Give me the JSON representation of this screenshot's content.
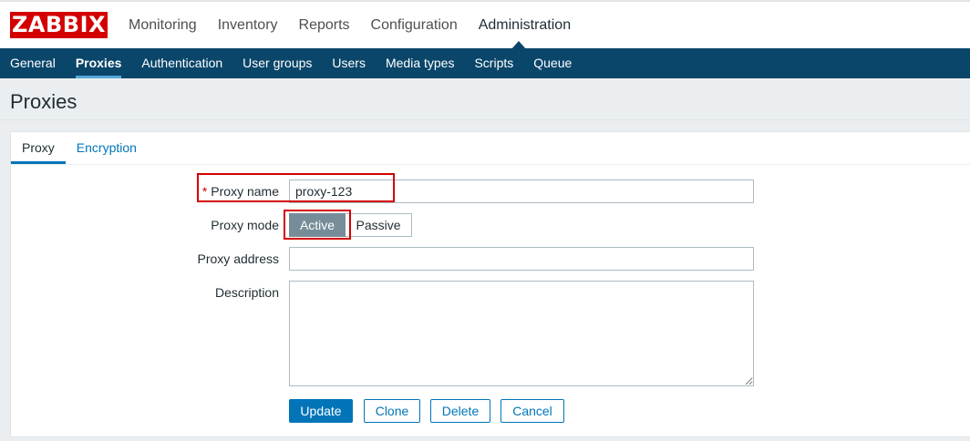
{
  "brand": {
    "logo_text": "ZABBIX",
    "accent": "#d40000"
  },
  "main_menu": {
    "items": [
      {
        "label": "Monitoring"
      },
      {
        "label": "Inventory"
      },
      {
        "label": "Reports"
      },
      {
        "label": "Configuration"
      },
      {
        "label": "Administration"
      }
    ],
    "active": "Administration"
  },
  "sub_menu": {
    "items": [
      {
        "label": "General"
      },
      {
        "label": "Proxies"
      },
      {
        "label": "Authentication"
      },
      {
        "label": "User groups"
      },
      {
        "label": "Users"
      },
      {
        "label": "Media types"
      },
      {
        "label": "Scripts"
      },
      {
        "label": "Queue"
      }
    ],
    "active": "Proxies",
    "background": "#0a466a"
  },
  "page": {
    "title": "Proxies"
  },
  "tabs": {
    "items": [
      {
        "label": "Proxy"
      },
      {
        "label": "Encryption"
      }
    ],
    "active": "Proxy"
  },
  "form": {
    "proxy_name": {
      "required_mark": "*",
      "label": "Proxy name",
      "value": "proxy-123"
    },
    "proxy_mode": {
      "label": "Proxy mode",
      "options": [
        "Active",
        "Passive"
      ],
      "selected": "Active"
    },
    "proxy_address": {
      "label": "Proxy address",
      "value": ""
    },
    "description": {
      "label": "Description",
      "value": ""
    }
  },
  "buttons": {
    "update": "Update",
    "clone": "Clone",
    "delete": "Delete",
    "cancel": "Cancel"
  }
}
